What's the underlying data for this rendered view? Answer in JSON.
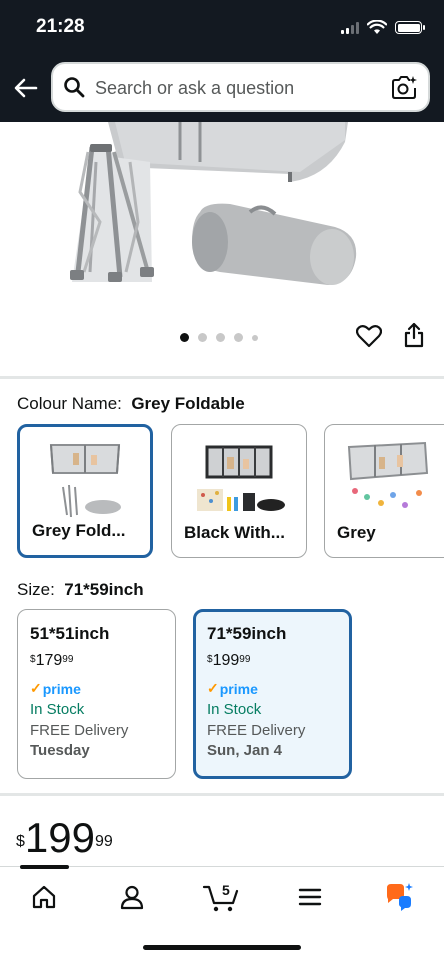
{
  "status_bar": {
    "time": "21:28"
  },
  "search": {
    "placeholder": "Search or ask a question"
  },
  "gallery": {
    "image_count": 5,
    "active_index": 0
  },
  "colour": {
    "label": "Colour Name:",
    "selected": "Grey Foldable",
    "options": [
      {
        "name": "Grey Fold..."
      },
      {
        "name": "Black With..."
      },
      {
        "name": "Grey"
      }
    ]
  },
  "size": {
    "label": "Size:",
    "selected": "71*59inch",
    "options": [
      {
        "name": "51*51inch",
        "currency": "$",
        "whole": "179",
        "cents": "99",
        "prime": "prime",
        "stock": "In Stock",
        "delivery": "FREE Delivery",
        "day": "Tuesday"
      },
      {
        "name": "71*59inch",
        "currency": "$",
        "whole": "199",
        "cents": "99",
        "prime": "prime",
        "stock": "In Stock",
        "delivery": "FREE Delivery",
        "day": "Sun, Jan 4"
      }
    ]
  },
  "price": {
    "currency": "$",
    "whole": "199",
    "cents": "99"
  },
  "bottom_nav": {
    "cart_count": "5"
  },
  "colors": {
    "header_bg": "#131921",
    "selected_border": "#2162a1",
    "stock_green": "#067d62",
    "prime_blue": "#1a98ff",
    "prime_orange": "#ff9900"
  }
}
